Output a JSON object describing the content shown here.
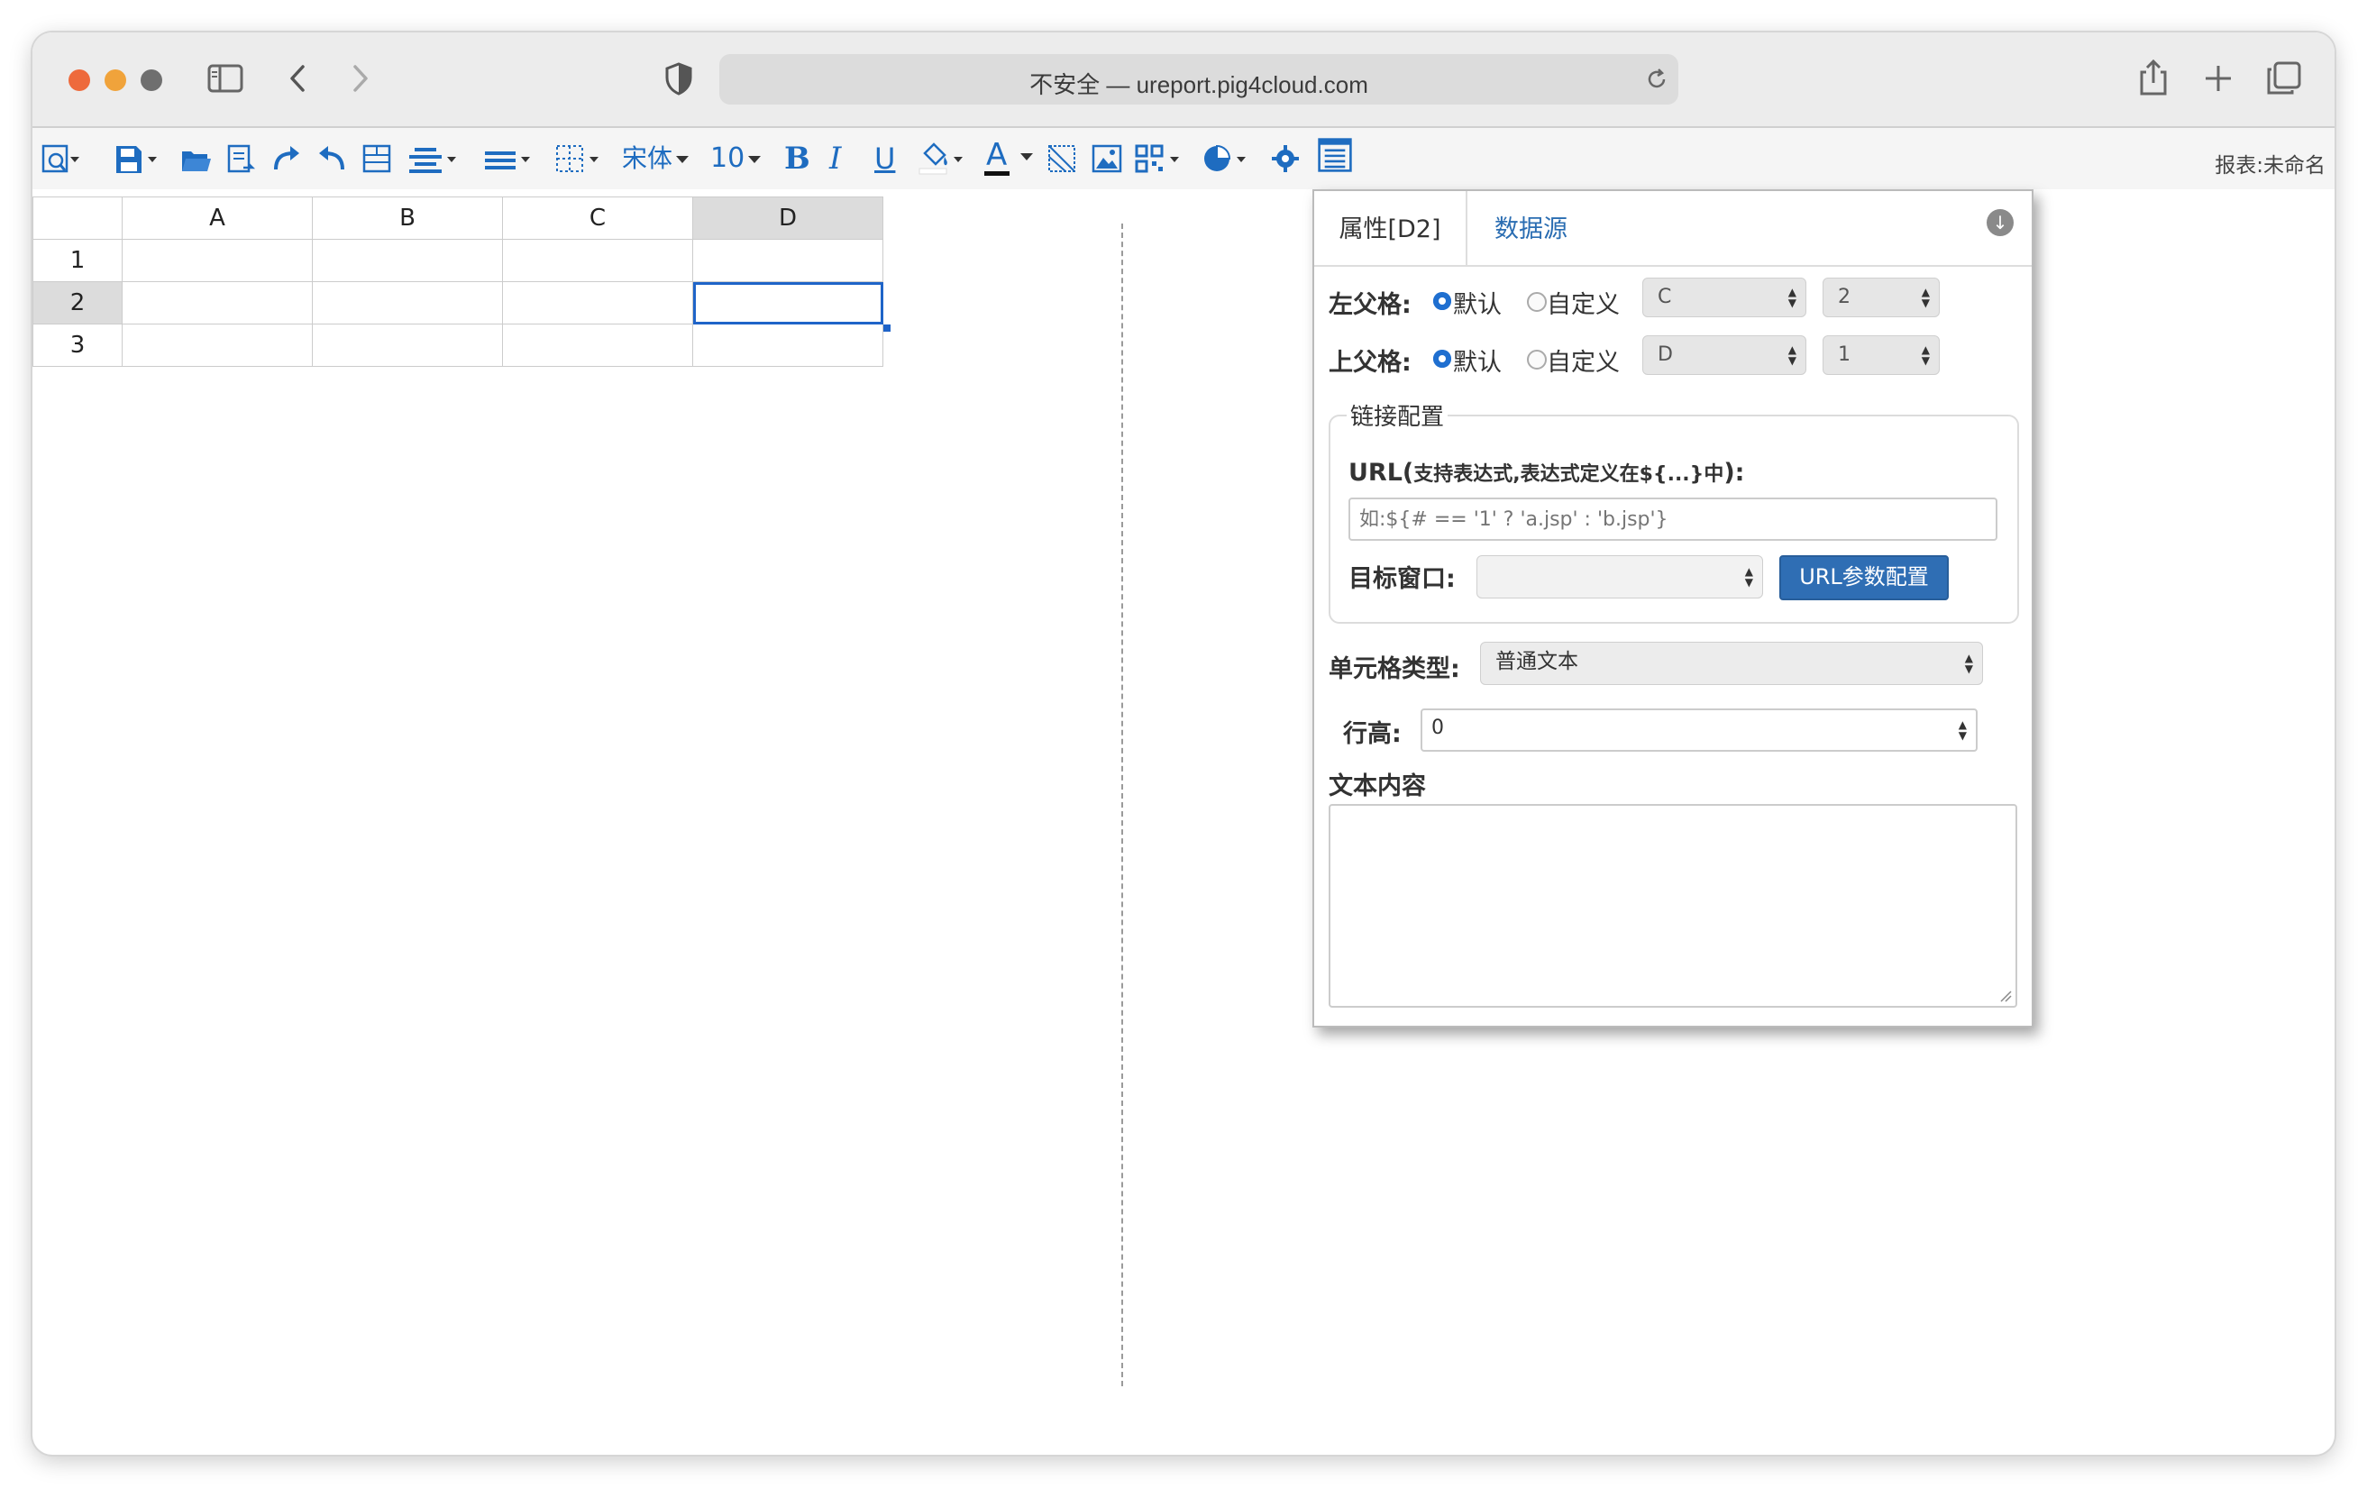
{
  "browser": {
    "address": "不安全 — ureport.pig4cloud.com"
  },
  "toolbar": {
    "font_family": "宋体",
    "font_size": "10",
    "bold": "B",
    "italic": "I",
    "underline": "U",
    "font_color": "A",
    "report_name": "报表:未命名"
  },
  "sheet": {
    "columns": [
      "A",
      "B",
      "C",
      "D"
    ],
    "rows": [
      "1",
      "2",
      "3"
    ],
    "selected_cell": "D2"
  },
  "panel": {
    "tab_properties": "属性[D2]",
    "tab_datasource": "数据源",
    "left_parent_label": "左父格:",
    "top_parent_label": "上父格:",
    "radio_default": "默认",
    "radio_custom": "自定义",
    "left_parent_col": "C",
    "left_parent_row": "2",
    "top_parent_col": "D",
    "top_parent_row": "1",
    "link_legend": "链接配置",
    "url_label_main": "URL(",
    "url_label_sub": "支持表达式,表达式定义在${...}中",
    "url_label_end": "):",
    "url_placeholder": "如:${# == '1' ? 'a.jsp' : 'b.jsp'}",
    "target_label": "目标窗口:",
    "target_value": "",
    "url_params_button": "URL参数配置",
    "cell_type_label": "单元格类型:",
    "cell_type_value": "普通文本",
    "row_height_label": "行高:",
    "row_height_value": "0",
    "text_content_label": "文本内容",
    "text_content_value": ""
  }
}
